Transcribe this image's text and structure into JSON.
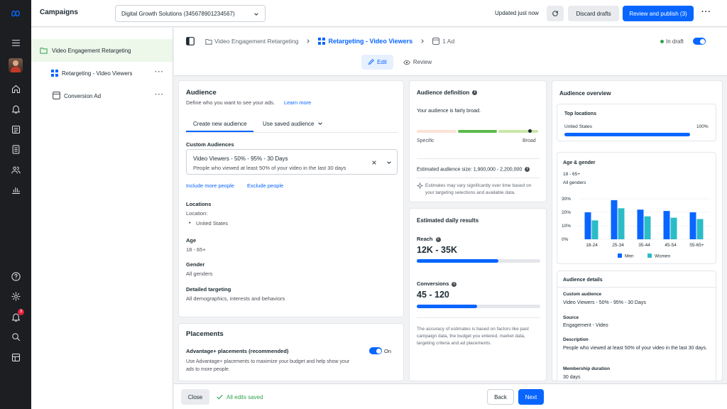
{
  "topbar": {
    "title": "Campaigns",
    "account_select": "Digital Growth Solutions (345678901234567)",
    "status": "Updated just now",
    "discard_label": "Discard drafts",
    "publish_label": "Review and publish (3)"
  },
  "tree": {
    "items": [
      {
        "label": "Video Engagement Retargeting"
      },
      {
        "label": "Retargeting - Video Viewers"
      },
      {
        "label": "Conversion Ad"
      }
    ]
  },
  "header": {
    "breadcrumb": [
      "Video Engagement Retargeting",
      "Retargeting - Video Viewers",
      "1 Ad"
    ],
    "draft_status": "In draft",
    "tabs": [
      "Edit",
      "Review"
    ]
  },
  "audience": {
    "title": "Audience",
    "description": "Define who you want to see your ads.",
    "learn_more": "Learn more",
    "tabs": [
      "Create new audience",
      "Use saved audience"
    ],
    "custom_label": "Custom Audiences",
    "custom_name": "Video Viewers - 50% - 95% - 30 Days",
    "custom_desc": "People who viewed at least 50% of your video in the last 30 days",
    "include_link": "Include more people",
    "exclude_link": "Exclude people",
    "locations_label": "Locations",
    "location_sub": "Location:",
    "location_value": "United States",
    "age_label": "Age",
    "age_value": "18 - 65+",
    "gender_label": "Gender",
    "gender_value": "All genders",
    "detailed_label": "Detailed targeting",
    "detailed_value": "All demographics, interests and behaviors"
  },
  "placements": {
    "title": "Placements",
    "option_label": "Advantage+ placements (recommended)",
    "toggle_label": "On",
    "description": "Use Advantage+ placements to maximize your budget and help show your ads to more people."
  },
  "definition": {
    "title": "Audience definition",
    "status": "Your audience is fairly broad.",
    "specific": "Specific",
    "broad": "Broad",
    "size": "Estimated audience size: 1,900,000 - 2,200,000",
    "note": "Estimates may vary significantly over time based on your targeting selections and available data."
  },
  "daily": {
    "title": "Estimated daily results",
    "reach_label": "Reach",
    "reach_value": "12K - 35K",
    "reach_fill": 0.66,
    "conv_label": "Conversions",
    "conv_value": "45 - 120",
    "conv_fill": 0.49,
    "note": "The accuracy of estimates is based on factors like past campaign data, the budget you entered, market data, targeting criteria and ad placements."
  },
  "overview": {
    "title": "Audience overview",
    "top_locations": "Top locations",
    "loc_name": "United States",
    "loc_pct": "100%",
    "age_gender_title": "Age & gender",
    "age_range": "18 - 65+",
    "genders": "All genders",
    "details_title": "Audience details",
    "custom_audience_label": "Custom audience",
    "custom_audience_value": "Video Viewers - 50% - 95% - 30 Days",
    "source_label": "Source",
    "source_value": "Engagement - Video",
    "description_label": "Description",
    "description_value": "People who viewed at least 50% of your video in the last 30 days.",
    "membership_label": "Membership duration",
    "membership_value": "30 days"
  },
  "chart_data": {
    "type": "bar",
    "categories": [
      "18-24",
      "25-34",
      "35-44",
      "45-54",
      "55-65+"
    ],
    "series": [
      {
        "name": "Men",
        "values": [
          20,
          29,
          22,
          21,
          20
        ],
        "color": "#0866ff"
      },
      {
        "name": "Women",
        "values": [
          14,
          23,
          17,
          16,
          15
        ],
        "color": "#2bbcc8"
      }
    ],
    "yticks": [
      "0%",
      "10%",
      "20%",
      "30%"
    ],
    "ylim": [
      0,
      30
    ],
    "legend": "bottom"
  },
  "footer": {
    "close_label": "Close",
    "saved_label": "All edits saved",
    "back_label": "Back",
    "next_label": "Next"
  },
  "notifications": {
    "count": "3"
  },
  "colors": {
    "accent": "#0866ff",
    "success": "#31a24c",
    "teal": "#2bbcc8"
  }
}
